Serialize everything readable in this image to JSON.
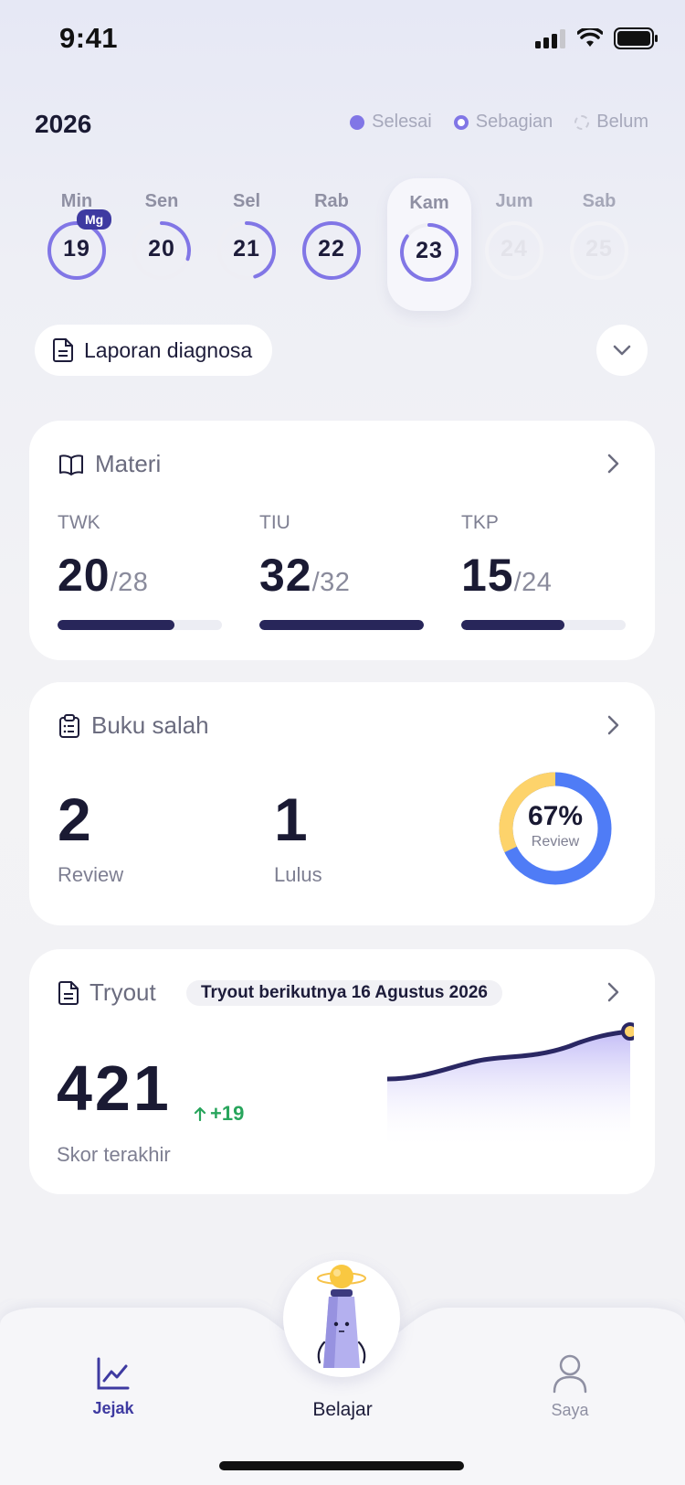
{
  "status_bar": {
    "time": "9:41"
  },
  "header": {
    "year": "2026",
    "legend": [
      {
        "label": "Selesai",
        "style": "full"
      },
      {
        "label": "Sebagian",
        "style": "ring"
      },
      {
        "label": "Belum",
        "style": "dashed"
      }
    ]
  },
  "days": [
    {
      "name": "Min",
      "num": "19",
      "progress": 1.0,
      "badge": "Mg"
    },
    {
      "name": "Sen",
      "num": "20",
      "progress": 0.3
    },
    {
      "name": "Sel",
      "num": "21",
      "progress": 0.45
    },
    {
      "name": "Rab",
      "num": "22",
      "progress": 1.0
    },
    {
      "name": "Kam",
      "num": "23",
      "progress": 0.85,
      "selected": true
    },
    {
      "name": "Jum",
      "num": "24",
      "progress": 0
    },
    {
      "name": "Sab",
      "num": "25",
      "progress": 0
    }
  ],
  "report": {
    "label": "Laporan diagnosa"
  },
  "materi": {
    "title": "Materi",
    "subjects": [
      {
        "label": "TWK",
        "done": "20",
        "total": "/28",
        "fraction": 0.71
      },
      {
        "label": "TIU",
        "done": "32",
        "total": "/32",
        "fraction": 1.0
      },
      {
        "label": "TKP",
        "done": "15",
        "total": "/24",
        "fraction": 0.63
      }
    ]
  },
  "buku_salah": {
    "title": "Buku salah",
    "review_count": "2",
    "review_label": "Review",
    "lulus_count": "1",
    "lulus_label": "Lulus",
    "donut_percent": "67%",
    "donut_label": "Review",
    "donut_fraction": 0.67
  },
  "tryout": {
    "title": "Tryout",
    "next_label": "Tryout berikutnya 16 Agustus 2026",
    "score": "421",
    "delta": "+19",
    "score_label": "Skor terakhir"
  },
  "nav": {
    "left": "Jejak",
    "center": "Belajar",
    "right": "Saya"
  },
  "colors": {
    "accent": "#8176e6",
    "dark_bar": "#28265a",
    "donut_yellow": "#fdd36b",
    "donut_blue": "#4f7cf6",
    "positive": "#28a55c"
  }
}
